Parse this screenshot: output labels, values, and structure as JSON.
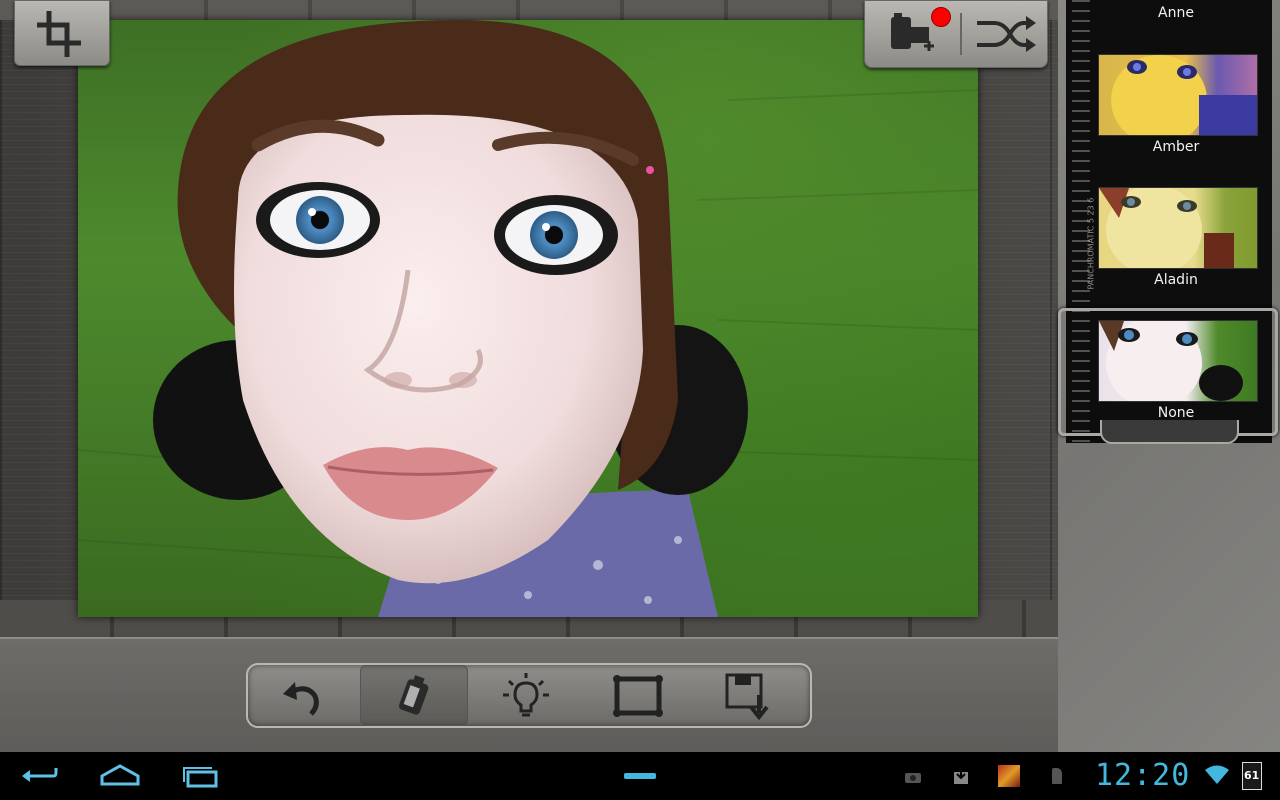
{
  "filters": [
    {
      "name": "Anne"
    },
    {
      "name": "Amber"
    },
    {
      "name": "Aladin"
    },
    {
      "name": "None"
    }
  ],
  "selected_filter": "None",
  "film_edge_text": "PANCHROMATIC 5 23 6",
  "notification": {
    "dot_color": "#ff0000"
  },
  "toolbar": {
    "tools": [
      "undo-icon",
      "film-roll-icon",
      "light-bulb-icon",
      "frame-icon",
      "save-icon"
    ],
    "active_tool": "film-roll-icon"
  },
  "system": {
    "time": "12:20",
    "battery": "61",
    "accent_color": "#43b8de"
  },
  "icons": {
    "top_left": "crop-icon",
    "top_right": [
      "film-add-icon",
      "shuffle-icon"
    ]
  }
}
